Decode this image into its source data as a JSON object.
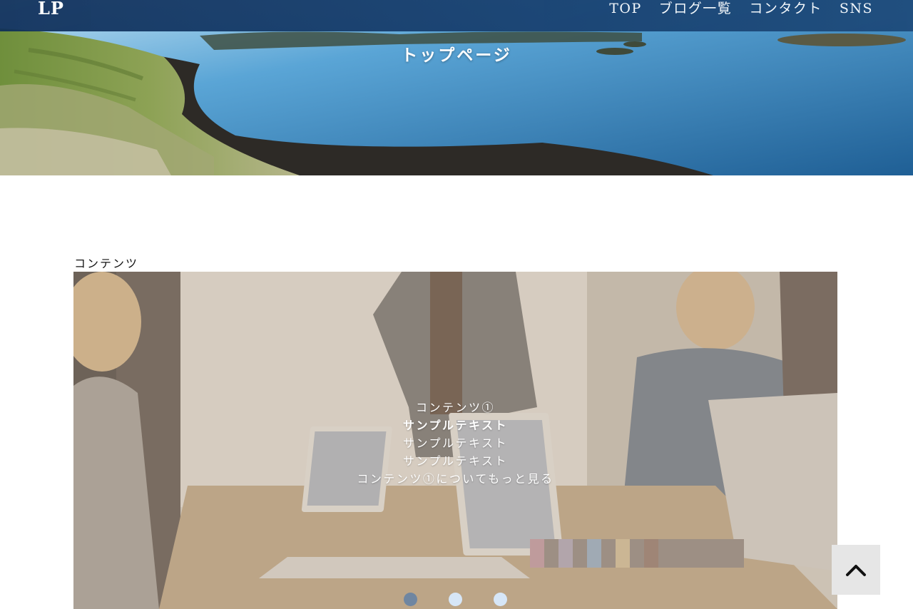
{
  "header": {
    "logo": "LP",
    "nav": [
      {
        "label": "TOP"
      },
      {
        "label": "ブログ一覧"
      },
      {
        "label": "コンタクト"
      },
      {
        "label": "SNS"
      }
    ]
  },
  "hero": {
    "title": "トップページ"
  },
  "section": {
    "label": "コンテンツ"
  },
  "slider": {
    "heading": "コンテンツ①",
    "lines": [
      "サンプルテキスト",
      "サンプルテキスト",
      "サンプルテキスト"
    ],
    "link_text": "コンテンツ①についてもっと見る",
    "dots": [
      {
        "active": true
      },
      {
        "active": false
      },
      {
        "active": false
      }
    ]
  },
  "colors": {
    "navbar": "#163d6c",
    "dot_active": "#6f86a1",
    "dot_inactive": "#d6e6f7",
    "to_top_bg": "#e6e6e6"
  },
  "icons": {
    "to_top": "chevron-up-icon"
  }
}
